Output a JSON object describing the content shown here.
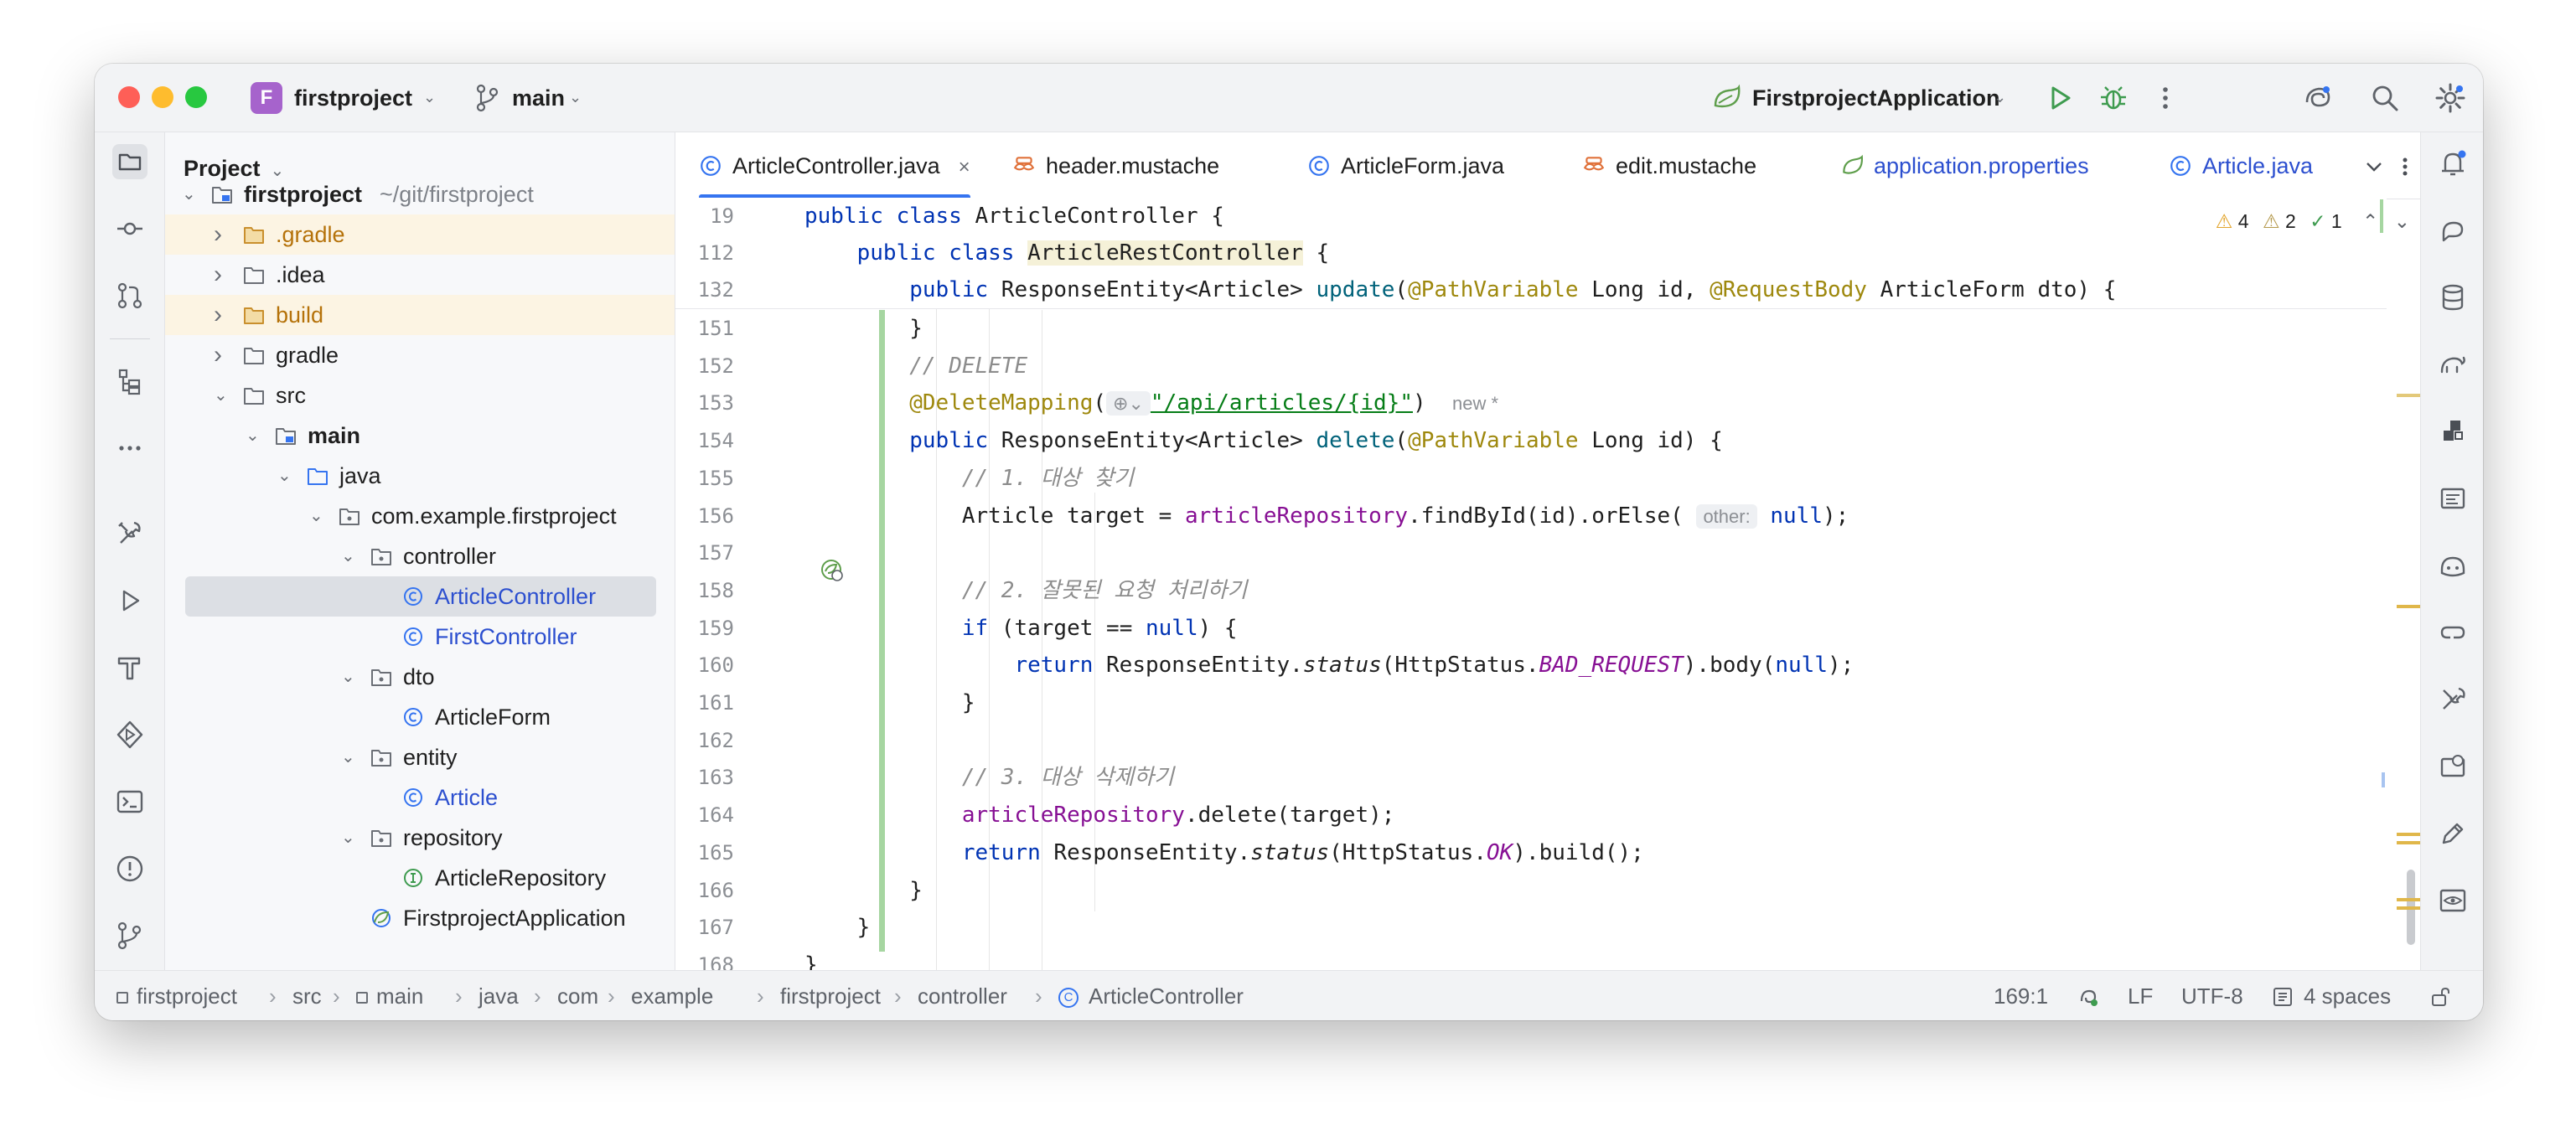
{
  "titlebar": {
    "project_initial": "F",
    "project_name": "firstproject",
    "branch": "main",
    "run_config": "FirstprojectApplication"
  },
  "project_panel": {
    "title": "Project",
    "tree": [
      {
        "label": "firstproject",
        "suffix": "~/git/firstproject",
        "depth": 0,
        "expanded": true,
        "kind": "module",
        "bold": true
      },
      {
        "label": ".gradle",
        "depth": 1,
        "expanded": false,
        "kind": "folder-excluded"
      },
      {
        "label": ".idea",
        "depth": 1,
        "expanded": false,
        "kind": "folder"
      },
      {
        "label": "build",
        "depth": 1,
        "expanded": false,
        "kind": "folder-excluded"
      },
      {
        "label": "gradle",
        "depth": 1,
        "expanded": false,
        "kind": "folder"
      },
      {
        "label": "src",
        "depth": 1,
        "expanded": true,
        "kind": "folder"
      },
      {
        "label": "main",
        "depth": 2,
        "expanded": true,
        "kind": "module",
        "bold": true
      },
      {
        "label": "java",
        "depth": 3,
        "expanded": true,
        "kind": "source-folder"
      },
      {
        "label": "com.example.firstproject",
        "depth": 4,
        "expanded": true,
        "kind": "package"
      },
      {
        "label": "controller",
        "depth": 5,
        "expanded": true,
        "kind": "package"
      },
      {
        "label": "ArticleController",
        "depth": 6,
        "kind": "class",
        "selected": true
      },
      {
        "label": "FirstController",
        "depth": 6,
        "kind": "class"
      },
      {
        "label": "dto",
        "depth": 5,
        "expanded": true,
        "kind": "package"
      },
      {
        "label": "ArticleForm",
        "depth": 6,
        "kind": "class-plain"
      },
      {
        "label": "entity",
        "depth": 5,
        "expanded": true,
        "kind": "package"
      },
      {
        "label": "Article",
        "depth": 6,
        "kind": "class"
      },
      {
        "label": "repository",
        "depth": 5,
        "expanded": true,
        "kind": "package"
      },
      {
        "label": "ArticleRepository",
        "depth": 6,
        "kind": "interface"
      },
      {
        "label": "FirstprojectApplication",
        "depth": 5,
        "kind": "spring-class"
      }
    ]
  },
  "tabs": [
    {
      "label": "ArticleController.java",
      "icon": "class-icon",
      "active": true
    },
    {
      "label": "header.mustache",
      "icon": "mustache-icon"
    },
    {
      "label": "ArticleForm.java",
      "icon": "class-icon"
    },
    {
      "label": "edit.mustache",
      "icon": "mustache-icon"
    },
    {
      "label": "application.properties",
      "icon": "spring-properties-icon"
    },
    {
      "label": "Article.java",
      "icon": "class-icon"
    }
  ],
  "inspections": {
    "warnings": "4",
    "weak_warnings": "2",
    "ok": "1"
  },
  "sticky_lines": [
    {
      "num": "19",
      "html": "<span class='kw'>public class</span> ArticleController {"
    },
    {
      "num": "112",
      "html": "    <span class='kw'>public class</span> <span class='hl-yellow'>ArticleRestController</span> {"
    },
    {
      "num": "132",
      "html": "        <span class='kw'>public</span> ResponseEntity&lt;Article&gt; <span style='color:#00627a'>update</span>(<span class='ann'>@PathVariable</span> Long id, <span class='ann'>@RequestBody</span> ArticleForm dto) {"
    }
  ],
  "code_lines": [
    {
      "num": "151",
      "html": "        }"
    },
    {
      "num": "152",
      "html": "        <span class='cm'>// DELETE</span>"
    },
    {
      "num": "153",
      "html": "        <span class='ann'>@DeleteMapping</span>(<span class='hint'>⊕⌄</span><span class='str'>\"/api/articles/{id}\"</span>)  <span class='newhint'>new *</span>"
    },
    {
      "num": "154",
      "html": "        <span class='kw'>public</span> ResponseEntity&lt;Article&gt; <span style='color:#00627a'>delete</span>(<span class='ann'>@PathVariable</span> Long id) {"
    },
    {
      "num": "155",
      "html": "            <span class='cm'>// 1. 대상 찾기</span>"
    },
    {
      "num": "156",
      "html": "            Article target = <span class='fld'>articleRepository</span>.findById(id).orElse( <span class='hint'>other:</span> <span class='kw'>null</span>);"
    },
    {
      "num": "157",
      "html": ""
    },
    {
      "num": "158",
      "html": "            <span class='cm'>// 2. 잘못된 요청 처리하기</span>"
    },
    {
      "num": "159",
      "html": "            <span class='kw'>if</span> (target == <span class='kw'>null</span>) {"
    },
    {
      "num": "160",
      "html": "                <span class='kw'>return</span> ResponseEntity.<span class='stat'>status</span>(HttpStatus.<span class='const'>BAD_REQUEST</span>).body(<span class='kw'>null</span>);"
    },
    {
      "num": "161",
      "html": "            }"
    },
    {
      "num": "162",
      "html": ""
    },
    {
      "num": "163",
      "html": "            <span class='cm'>// 3. 대상 삭제하기</span>"
    },
    {
      "num": "164",
      "html": "            <span class='fld'>articleRepository</span>.delete(target);"
    },
    {
      "num": "165",
      "html": "            <span class='kw'>return</span> ResponseEntity.<span class='stat'>status</span>(HttpStatus.<span class='const'>OK</span>).build();"
    },
    {
      "num": "166",
      "html": "        }"
    },
    {
      "num": "167",
      "html": "    }"
    },
    {
      "num": "168",
      "html": "}"
    }
  ],
  "breadcrumbs": [
    "firstproject",
    "src",
    "main",
    "java",
    "com",
    "example",
    "firstproject",
    "controller",
    "ArticleController"
  ],
  "status": {
    "position": "169:1",
    "line_sep": "LF",
    "encoding": "UTF-8",
    "indent": "4 spaces"
  },
  "colors": {
    "accent": "#3574f0",
    "vcs_added": "#a6d6a1",
    "excluded_bg": "#fcf4e3"
  }
}
